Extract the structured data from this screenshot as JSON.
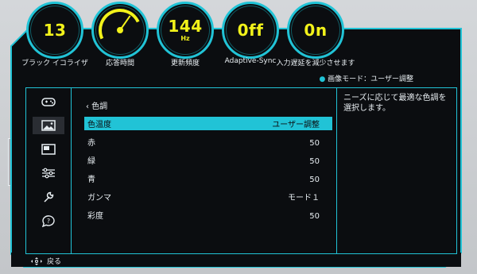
{
  "gauges": [
    {
      "value": "13",
      "unit": "",
      "label": "ブラック イコライザ"
    },
    {
      "value": "",
      "unit": "",
      "label": "応答時間"
    },
    {
      "value": "144",
      "unit": "Hz",
      "label": "更新頻度"
    },
    {
      "value": "0ff",
      "unit": "",
      "label": "Adaptive-Sync"
    },
    {
      "value": "0n",
      "unit": "",
      "label": "入力遅延を減少させます"
    }
  ],
  "mode_bar": {
    "bullet": "●",
    "text": "画像モード：ユーザー調整"
  },
  "sidebar": {
    "items": [
      {
        "icon": "gamepad-icon"
      },
      {
        "icon": "picture-icon",
        "active": true
      },
      {
        "icon": "screen-icon"
      },
      {
        "icon": "sliders-icon"
      },
      {
        "icon": "wrench-icon"
      },
      {
        "icon": "help-icon"
      }
    ]
  },
  "content": {
    "breadcrumb": "‹ 色調",
    "rows": [
      {
        "label": "色温度",
        "value": "ユーザー調整",
        "selected": true
      },
      {
        "label": "赤",
        "value": "50"
      },
      {
        "label": "緑",
        "value": "50"
      },
      {
        "label": "青",
        "value": "50"
      },
      {
        "label": "ガンマ",
        "value": "モード１"
      },
      {
        "label": "彩度",
        "value": "50"
      }
    ]
  },
  "help": {
    "text": "ニーズに応じて最適な色調を選択します。"
  },
  "bottom": {
    "back_label": "戻る"
  },
  "colors": {
    "accent": "#21c3d6",
    "gauge_text": "#f2f21a",
    "panel": "#0b0d10"
  }
}
